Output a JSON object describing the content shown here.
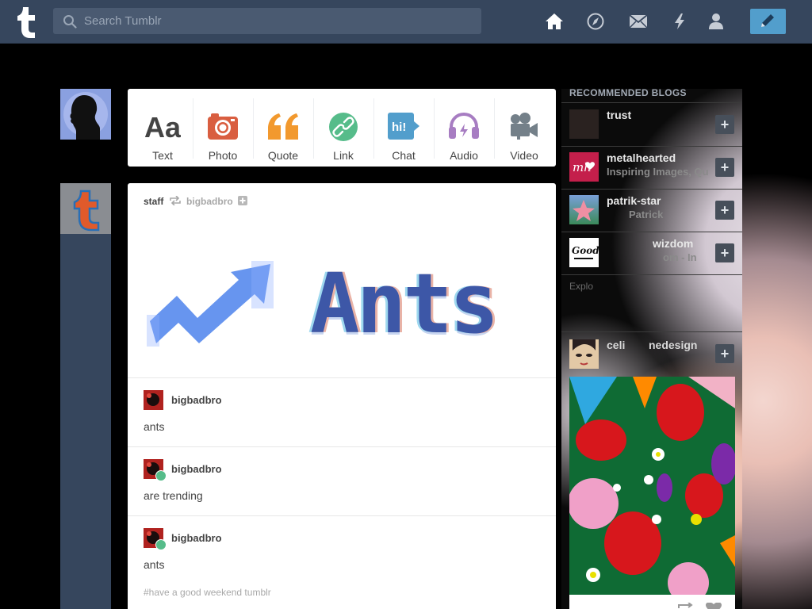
{
  "topbar": {
    "search_placeholder": "Search Tumblr",
    "nav_icons": [
      "home-icon",
      "explore-icon",
      "mail-icon",
      "activity-icon",
      "account-icon"
    ],
    "compose_icon": "pencil-icon"
  },
  "composer": {
    "types": [
      {
        "label": "Text",
        "icon": "text-icon",
        "color": "#444444"
      },
      {
        "label": "Photo",
        "icon": "camera-icon",
        "color": "#d95e40"
      },
      {
        "label": "Quote",
        "icon": "quote-icon",
        "color": "#f2992e"
      },
      {
        "label": "Link",
        "icon": "link-icon",
        "color": "#56bc8a"
      },
      {
        "label": "Chat",
        "icon": "chat-icon",
        "color": "#529ecc"
      },
      {
        "label": "Audio",
        "icon": "headphones-icon",
        "color": "#a77dc2"
      },
      {
        "label": "Video",
        "icon": "video-icon",
        "color": "#748089"
      }
    ]
  },
  "post": {
    "author": "staff",
    "reblogged_from": "bigbadbro",
    "banner_text": "Ants",
    "replies": [
      {
        "user": "bigbadbro",
        "text": "ants"
      },
      {
        "user": "bigbadbro",
        "text": "are trending"
      },
      {
        "user": "bigbadbro",
        "text": "ants"
      }
    ],
    "tags": "#have a good weekend tumblr"
  },
  "sidebar": {
    "title": "RECOMMENDED BLOGS",
    "blogs": [
      {
        "name": "trust",
        "subtitle": ""
      },
      {
        "name": "metalhearted",
        "subtitle": "Inspiring Images, Qu"
      },
      {
        "name": "patrik-star",
        "subtitle": "Patrick"
      },
      {
        "name": "wizdom",
        "subtitle": "om - In"
      }
    ],
    "explore_text": "Explo",
    "radar_blog": {
      "name": "celi",
      "name_tail": "nedesign"
    }
  },
  "colors": {
    "topbar": "#36465d",
    "accent": "#529ecc"
  }
}
